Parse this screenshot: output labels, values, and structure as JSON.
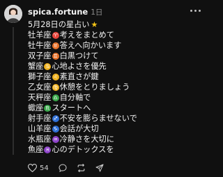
{
  "post": {
    "username": "spica.fortune",
    "time": "1日",
    "title": "5月28日の星占い",
    "title_icon": "star-icon",
    "lines": [
      {
        "sign": "牡羊座",
        "symbol": "♈",
        "color": "#e8453c",
        "text": "考えをまとめて"
      },
      {
        "sign": "牡牛座",
        "symbol": "♉",
        "color": "#e8732c",
        "text": "答えへ向かいます"
      },
      {
        "sign": "双子座",
        "symbol": "♊",
        "color": "#e8732c",
        "text": "白黒つけて"
      },
      {
        "sign": "蟹座",
        "symbol": "♋",
        "color": "#f0b21f",
        "text": "心地よさを優先"
      },
      {
        "sign": "獅子座",
        "symbol": "♌",
        "color": "#f0b21f",
        "text": "素直さが鍵"
      },
      {
        "sign": "乙女座",
        "symbol": "♍",
        "color": "#f0b21f",
        "text": "休憩をとりましょう"
      },
      {
        "sign": "天秤座",
        "symbol": "♎",
        "color": "#3aa84b",
        "text": "自分軸で"
      },
      {
        "sign": "蠍座",
        "symbol": "♏",
        "color": "#3aa84b",
        "text": "スタートへ"
      },
      {
        "sign": "射手座",
        "symbol": "♐",
        "color": "#2f6fd6",
        "text": "不安を膨らませないで"
      },
      {
        "sign": "山羊座",
        "symbol": "♑",
        "color": "#2f6fd6",
        "text": "会話が大切"
      },
      {
        "sign": "水瓶座",
        "symbol": "♒",
        "color": "#8e44c9",
        "text": "冷静さを大切に"
      },
      {
        "sign": "魚座",
        "symbol": "♓",
        "color": "#8e44c9",
        "text": "心のデトックスを"
      }
    ],
    "actions": {
      "like_count": "54",
      "like_icon": "heart-icon",
      "reply_icon": "comment-icon",
      "repost_icon": "repost-icon",
      "share_icon": "share-icon"
    }
  }
}
